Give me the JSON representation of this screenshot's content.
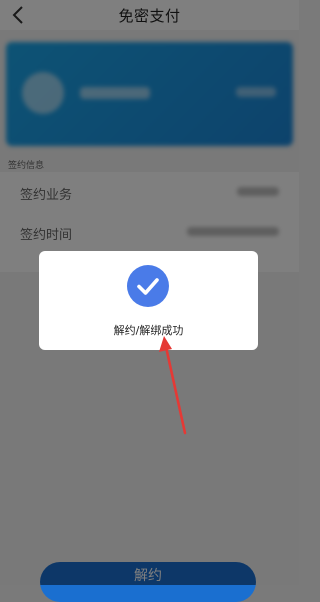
{
  "header": {
    "title": "免密支付",
    "back_icon": "chevron-left-icon"
  },
  "section": {
    "title": "签约信息"
  },
  "info_rows": [
    {
      "label": "签约业务"
    },
    {
      "label": "签约时间"
    }
  ],
  "bottom_button": {
    "label": "解约"
  },
  "dialog": {
    "message": "解约/解绑成功",
    "icon": "check-circle-icon"
  },
  "colors": {
    "accent": "#4a7be8",
    "card": "#1aa6ea",
    "button": "#1a6fd0",
    "arrow": "#e53935"
  }
}
